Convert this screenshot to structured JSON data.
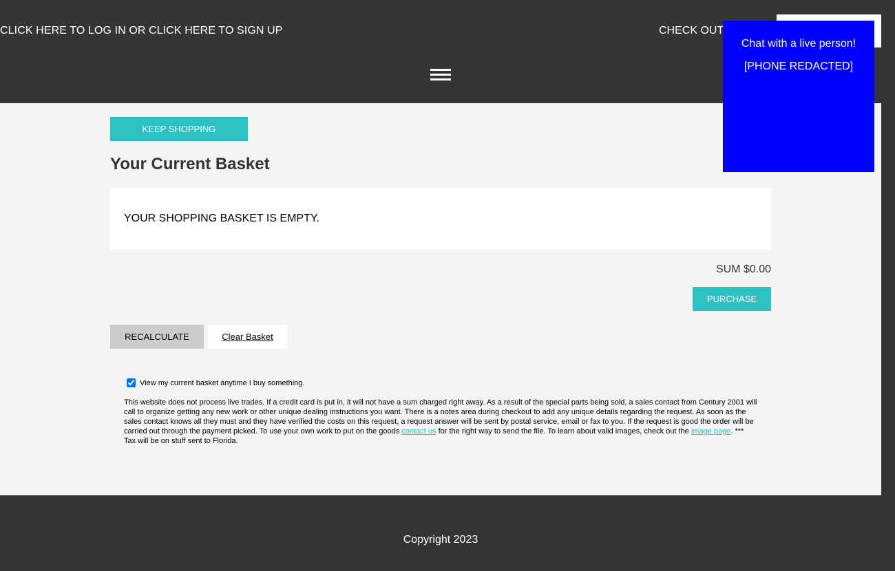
{
  "header": {
    "login_text": "CLICK HERE TO LOG IN OR CLICK HERE TO SIGN UP",
    "checkout_text": "CHECK OUT",
    "search_value": "",
    "menu_icon": "hamburger-menu-icon"
  },
  "chat": {
    "title": "Chat with a live person!",
    "phone": "[PHONE REDACTED]",
    "color": "#0000ff"
  },
  "main": {
    "keep_shopping_label": "KEEP SHOPPING",
    "title": "Your Current Basket",
    "empty_message": "YOUR SHOPPING BASKET IS EMPTY.",
    "sum_text": "SUM $0.00",
    "purchase_label": "PURCHASE",
    "recalculate_label": "RECALCULATE",
    "clear_basket_label": "Clear Basket",
    "checkbox_label": "View my current basket anytime I buy something.",
    "checkbox_checked": true,
    "notice_part1": "This website does not process live trades. If a credit card is put in, it will not have a sum charged right away. As a result of the special parts being sold, a sales contact from Century 2001 will call to organize getting any new work or other unique dealing instructions you want. There is a notes area during checkout to add any unique details regarding the request. As soon as the sales contact knows all they must and they have verified the costs on this request, a request answer will be sent by postal service, email or fax to you. If the request is good the order will be carried out through the payment picked. To use your own work to put on the goods ",
    "contact_link": "contact us",
    "notice_part2": " for the right way to send the file. To learn about valid images, check out the ",
    "image_link": "image page",
    "notice_part3": ". *** Tax will be on stuff sent to Florida."
  },
  "colors": {
    "accent": "#2ec1c4",
    "header_bg": "#353535",
    "body_bg": "#f4f4f4"
  },
  "footer": {
    "copyright": "Copyright 2023"
  }
}
